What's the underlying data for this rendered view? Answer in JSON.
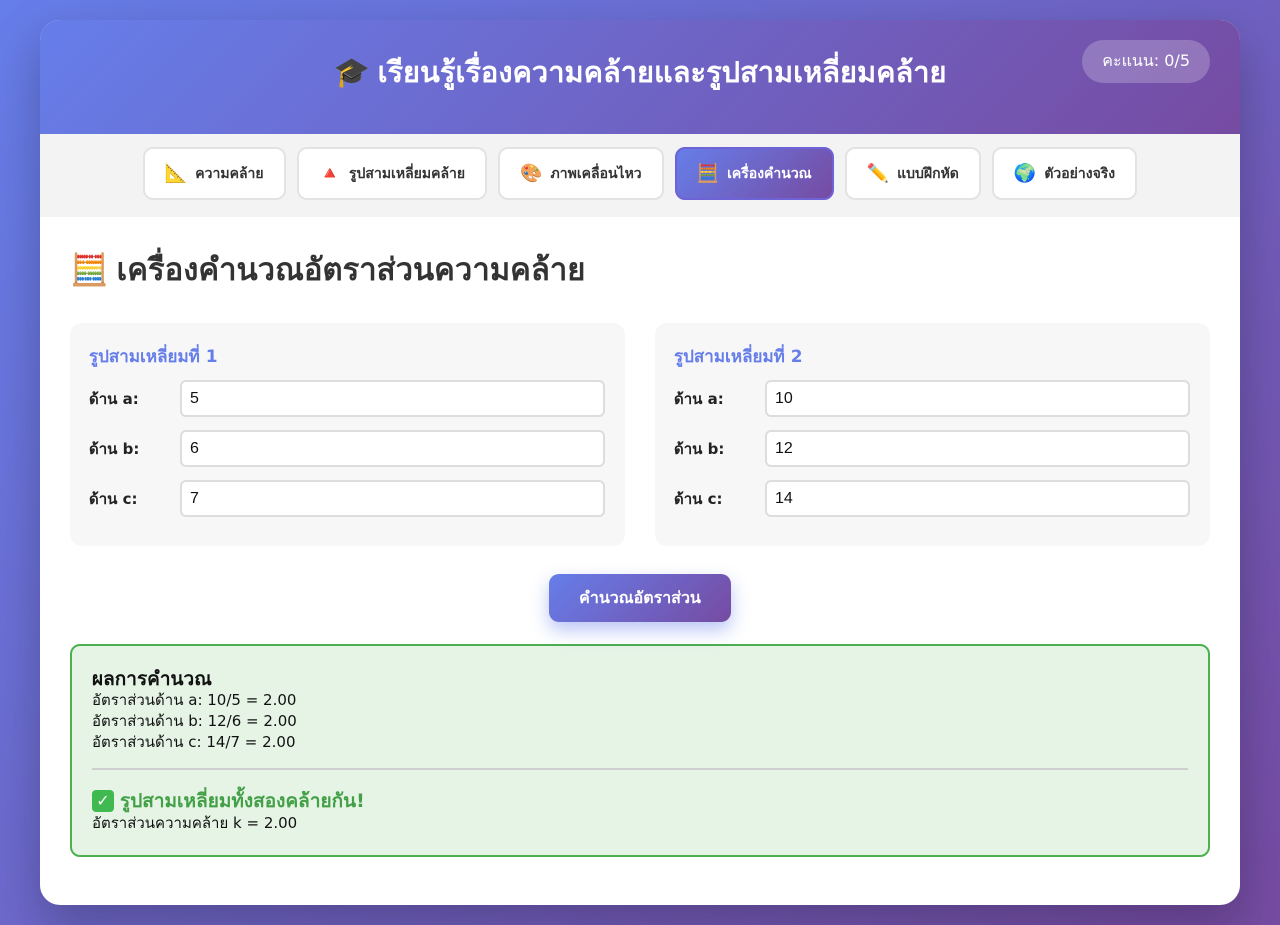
{
  "header": {
    "icon": "graduation-cap-icon",
    "title": "เรียนรู้เรื่องความคล้ายและรูปสามเหลี่ยมคล้าย",
    "score": "คะแนน: 0/5"
  },
  "tabs": [
    {
      "icon": "📐",
      "label": "ความคล้าย"
    },
    {
      "icon": "🔺",
      "label": "รูปสามเหลี่ยมคล้าย"
    },
    {
      "icon": "🎨",
      "label": "ภาพเคลื่อนไหว"
    },
    {
      "icon": "🧮",
      "label": "เครื่องคำนวณ"
    },
    {
      "icon": "✏️",
      "label": "แบบฝึกหัด"
    },
    {
      "icon": "🌍",
      "label": "ตัวอย่างจริง"
    }
  ],
  "section": {
    "icon": "🧮",
    "title": "เครื่องคำนวณอัตราส่วนความคล้าย"
  },
  "triangle1": {
    "title": "รูปสามเหลี่ยมที่ 1",
    "side_a_label": "ด้าน a:",
    "side_a": "5",
    "side_b_label": "ด้าน b:",
    "side_b": "6",
    "side_c_label": "ด้าน c:",
    "side_c": "7"
  },
  "triangle2": {
    "title": "รูปสามเหลี่ยมที่ 2",
    "side_a_label": "ด้าน a:",
    "side_a": "10",
    "side_b_label": "ด้าน b:",
    "side_b": "12",
    "side_c_label": "ด้าน c:",
    "side_c": "14"
  },
  "calc_button": "คำนวณอัตราส่วน",
  "result": {
    "title": "ผลการคำนวณ",
    "lines": [
      "อัตราส่วนด้าน a: 10/5 = 2.00",
      "อัตราส่วนด้าน b: 12/6 = 2.00",
      "อัตราส่วนด้าน c: 14/7 = 2.00"
    ],
    "status_icon": "check-mark-icon",
    "status": "รูปสามเหลี่ยมทั้งสองคล้ายกัน!",
    "ratio": "อัตราส่วนความคล้าย k = 2.00"
  },
  "colors": {
    "accent": "#667eea",
    "accent2": "#764ba2",
    "success": "#4caf50"
  }
}
